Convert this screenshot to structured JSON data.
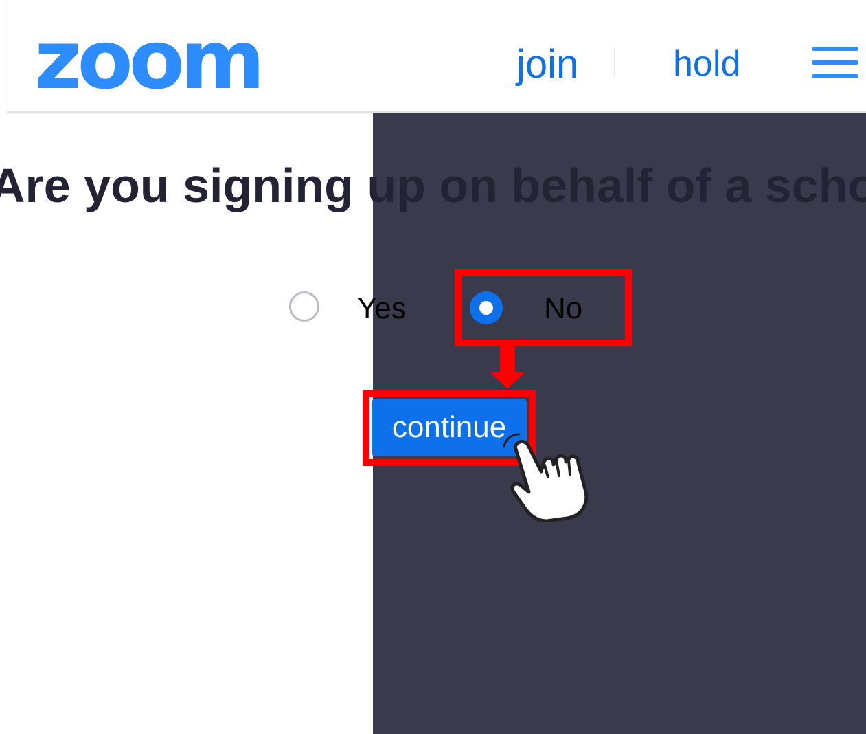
{
  "header": {
    "logo_text": "zoom",
    "nav": {
      "join_label": "join",
      "host_label": "hold"
    },
    "menu_icon": "hamburger-menu-icon"
  },
  "form": {
    "question": "Are you signing up on behalf of a schoo",
    "options": [
      {
        "label": "Yes",
        "selected": false
      },
      {
        "label": "No",
        "selected": true
      }
    ],
    "continue_label": "continue"
  },
  "annotations": {
    "highlight_color": "#ff0000",
    "pointer_icon": "hand-pointer-icon"
  },
  "colors": {
    "brand_blue": "#2d8cff",
    "button_blue": "#0e71eb",
    "overlay_dark": "#393a4c"
  }
}
